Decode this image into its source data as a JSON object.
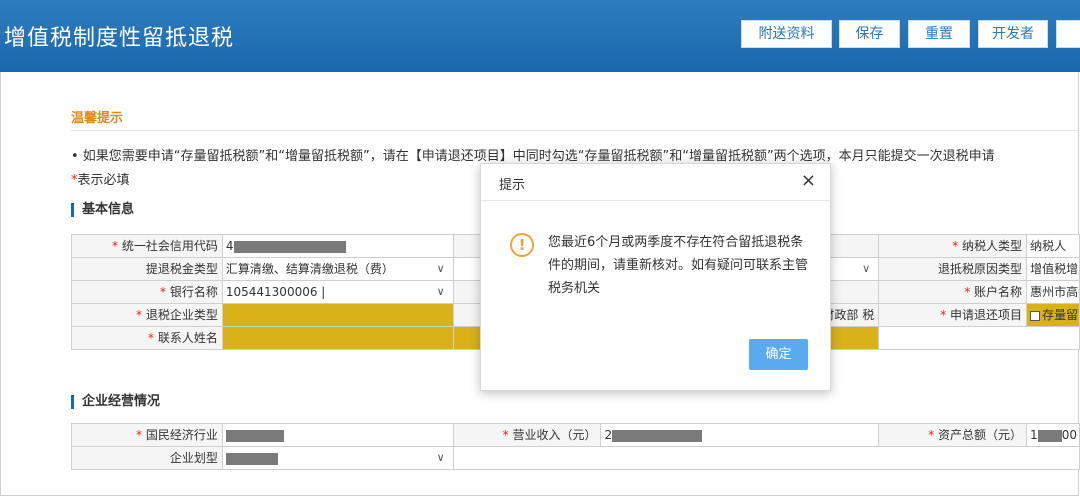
{
  "header": {
    "title": "增值税制度性留抵退税",
    "buttons": [
      "附送资料",
      "保存",
      "重置",
      "开发者"
    ]
  },
  "notice": {
    "title": "温馨提示",
    "text": "• 如果您需要申请“存量留抵税额”和“增量留抵税额”，请在【申请退还项目】中同时勾选“存量留抵税额”和“增量留抵税额”两个选项，本月只能提交一次退税申请",
    "required_asterisk": "*",
    "required_label": "表示必填"
  },
  "basic_info": {
    "section_title": "基本信息",
    "credit_code_label": "* 统一社会信用代码",
    "credit_code_prefix": "4",
    "taxpayer_type_label": "* 纳税人类型",
    "taxpayer_type_value": "纳税人",
    "refund_type_label": "提退税金类型",
    "refund_type_value": "汇算清缴、结算清缴退税（费）",
    "refund_reason_label": "退抵税原因类型",
    "refund_reason_value": "增值税增量",
    "bank_label": "* 银行名称",
    "bank_value": "105441300006 |",
    "account_label": "* 账户名称",
    "account_value": "惠州市高新",
    "enterprise_type_label": "* 退税企业类型",
    "mid_text": "财政部 税",
    "apply_item_label": "* 申请退还项目",
    "apply_item_value": "存量留",
    "contact_label": "* 联系人姓名"
  },
  "business": {
    "section_title": "企业经营情况",
    "industry_label": "* 国民经济行业",
    "revenue_label": "* 营业收入（元）",
    "revenue_prefix": "2",
    "assets_label": "* 资产总额（元）",
    "assets_prefix": "1",
    "assets_suffix": "00",
    "size_label": "企业划型"
  },
  "modal": {
    "title": "提示",
    "close_glyph": "×",
    "icon_glyph": "!",
    "message": "您最近6个月或两季度不存在符合留抵退税条件的期间，请重新核对。如有疑问可联系主管税务机关",
    "ok_label": "确定"
  },
  "icons": {
    "chevron": "∨"
  },
  "colors": {
    "header": "#1a67ae",
    "accent_orange": "#e48a16",
    "required_red": "#e0251b",
    "yellow_field": "#d9b21a",
    "ok_button": "#5aaaf0"
  }
}
